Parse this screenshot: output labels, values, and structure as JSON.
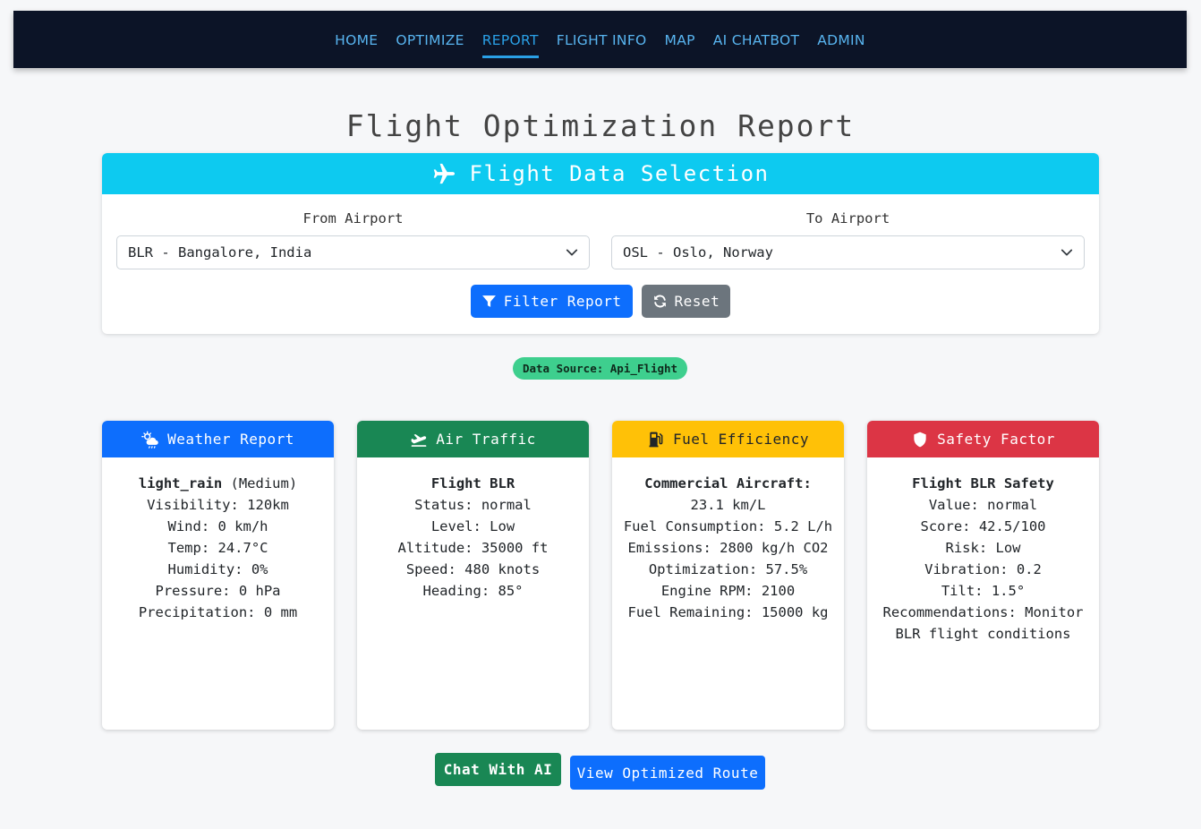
{
  "nav": {
    "items": [
      {
        "label": "HOME"
      },
      {
        "label": "OPTIMIZE"
      },
      {
        "label": "REPORT"
      },
      {
        "label": "FLIGHT INFO"
      },
      {
        "label": "MAP"
      },
      {
        "label": "AI CHATBOT"
      },
      {
        "label": "ADMIN"
      }
    ],
    "active": "REPORT"
  },
  "page_title": "Flight Optimization Report",
  "selection": {
    "header": "Flight Data Selection",
    "from_label": "From Airport",
    "from_value": "BLR - Bangalore, India",
    "to_label": "To Airport",
    "to_value": "OSL - Oslo, Norway",
    "filter_label": "Filter Report",
    "reset_label": "Reset"
  },
  "data_source": "Data Source: Api_Flight",
  "cards": {
    "weather": {
      "title": "Weather Report",
      "condition": "light_rain",
      "severity": "(Medium)",
      "lines": [
        "Visibility: 120km",
        "Wind: 0 km/h",
        "Temp: 24.7°C",
        "Humidity: 0%",
        "Pressure: 0 hPa",
        "Precipitation: 0 mm"
      ]
    },
    "traffic": {
      "title": "Air Traffic",
      "heading": "Flight BLR",
      "lines": [
        "Status: normal",
        "Level: Low",
        "Altitude: 35000 ft",
        "Speed: 480 knots",
        "Heading: 85°"
      ]
    },
    "fuel": {
      "title": "Fuel Efficiency",
      "heading": "Commercial Aircraft:",
      "lines": [
        "23.1 km/L",
        "Fuel Consumption: 5.2 L/h",
        "Emissions: 2800 kg/h CO2",
        "Optimization: 57.5%",
        "Engine RPM: 2100",
        "Fuel Remaining: 15000 kg"
      ]
    },
    "safety": {
      "title": "Safety Factor",
      "heading": "Flight BLR Safety",
      "lines": [
        "Value: normal",
        "Score: 42.5/100",
        "Risk: Low",
        "Vibration: 0.2",
        "Tilt: 1.5°",
        "Recommendations: Monitor BLR flight conditions"
      ]
    }
  },
  "actions": {
    "chat_label": "Chat With AI",
    "route_label": "View Optimized Route"
  },
  "colors": {
    "navbar": "#0c1427",
    "nav_link": "#58b4ef",
    "selection_header": "#0dcaf0",
    "weather": "#0d6efd",
    "traffic": "#198754",
    "fuel": "#ffc107",
    "safety": "#dc3545",
    "badge": "#3ecf8e"
  },
  "icons": {
    "selection_header": "plane-icon",
    "filter": "filter-icon",
    "reset": "sync-icon",
    "dropdown": "chevron-down-icon",
    "weather": "cloud-sun-rain-icon",
    "traffic": "plane-departure-icon",
    "fuel": "gas-pump-icon",
    "safety": "shield-icon"
  }
}
